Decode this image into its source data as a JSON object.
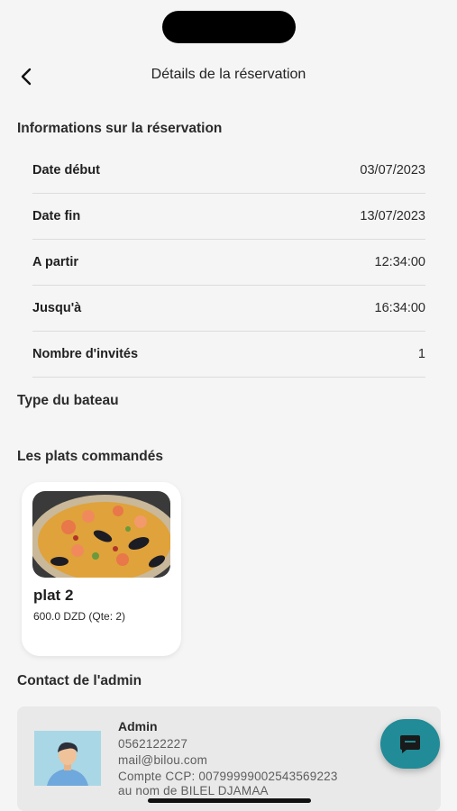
{
  "header": {
    "title": "Détails de la réservation",
    "back_icon": "chevron-left-icon"
  },
  "reservation": {
    "section_title": "Informations sur la réservation",
    "rows": [
      {
        "label": "Date début",
        "value": "03/07/2023"
      },
      {
        "label": "Date fin",
        "value": "13/07/2023"
      },
      {
        "label": "A partir",
        "value": "12:34:00"
      },
      {
        "label": "Jusqu'à",
        "value": "16:34:00"
      },
      {
        "label": "Nombre d'invités",
        "value": "1"
      }
    ]
  },
  "boat": {
    "section_title": "Type du bateau"
  },
  "plats": {
    "section_title": "Les plats commandés",
    "items": [
      {
        "name": "plat 2",
        "price": "600.0 DZD (Qte: 2)"
      }
    ]
  },
  "contact": {
    "section_title": "Contact de l'admin",
    "name": "Admin",
    "phone": "0562122227",
    "email": "mail@bilou.com",
    "ccp": "Compte CCP: 0079999900254356922​3",
    "holder": "au nom de BILEL DJAMAA"
  },
  "fab": {
    "icon": "chat-bubble-icon"
  },
  "colors": {
    "accent": "#218b97",
    "background": "#f5f5f5",
    "card": "#ffffff",
    "contact_bg": "#e9e9e9"
  }
}
